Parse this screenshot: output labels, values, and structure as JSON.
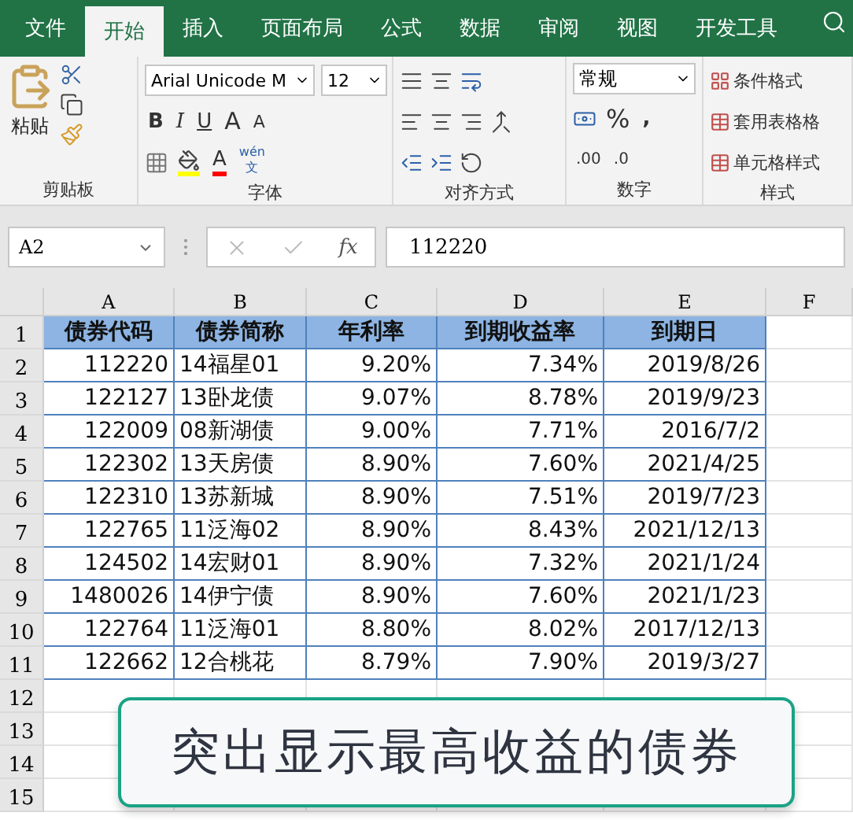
{
  "tabs": [
    {
      "label": "文件",
      "selected": false
    },
    {
      "label": "开始",
      "selected": true
    },
    {
      "label": "插入",
      "selected": false
    },
    {
      "label": "页面布局",
      "selected": false
    },
    {
      "label": "公式",
      "selected": false
    },
    {
      "label": "数据",
      "selected": false
    },
    {
      "label": "审阅",
      "selected": false
    },
    {
      "label": "视图",
      "selected": false
    },
    {
      "label": "开发工具",
      "selected": false
    }
  ],
  "ribbon": {
    "clipboard": {
      "paste": "粘贴",
      "label": "剪贴板"
    },
    "font": {
      "name": "Arial Unicode M",
      "size": "12",
      "bold": "B",
      "italic": "I",
      "underline": "U",
      "grow": "A",
      "shrink": "A",
      "font_color": "A",
      "phonetic": "wén",
      "phonetic_char": "文",
      "label": "字体"
    },
    "alignment": {
      "label": "对齐方式"
    },
    "number": {
      "format": "常规",
      "percent": "%",
      "comma": ",",
      "add_decimal": ".00",
      "remove_decimal": ".0",
      "label": "数字"
    },
    "styles": {
      "items": [
        "条件格式",
        "套用表格格",
        "单元格样式"
      ],
      "label": "样式"
    }
  },
  "formula_bar": {
    "name_box": "A2",
    "fx": "fx",
    "value": "112220"
  },
  "columns": [
    "A",
    "B",
    "C",
    "D",
    "E",
    "F"
  ],
  "header_row": {
    "number": "1",
    "cells": [
      "债券代码",
      "债券简称",
      "年利率",
      "到期收益率",
      "到期日"
    ]
  },
  "rows": [
    {
      "number": "2",
      "cells": [
        "112220",
        "14福星01",
        "9.20%",
        "7.34%",
        "2019/8/26"
      ]
    },
    {
      "number": "3",
      "cells": [
        "122127",
        "13卧龙债",
        "9.07%",
        "8.78%",
        "2019/9/23"
      ]
    },
    {
      "number": "4",
      "cells": [
        "122009",
        "08新湖债",
        "9.00%",
        "7.71%",
        "2016/7/2"
      ]
    },
    {
      "number": "5",
      "cells": [
        "122302",
        "13天房债",
        "8.90%",
        "7.60%",
        "2021/4/25"
      ]
    },
    {
      "number": "6",
      "cells": [
        "122310",
        "13苏新城",
        "8.90%",
        "7.51%",
        "2019/7/23"
      ]
    },
    {
      "number": "7",
      "cells": [
        "122765",
        "11泛海02",
        "8.90%",
        "8.43%",
        "2021/12/13"
      ]
    },
    {
      "number": "8",
      "cells": [
        "124502",
        "14宏财01",
        "8.90%",
        "7.32%",
        "2021/1/24"
      ]
    },
    {
      "number": "9",
      "cells": [
        "1480026",
        "14伊宁债",
        "8.90%",
        "7.60%",
        "2021/1/23"
      ]
    },
    {
      "number": "10",
      "cells": [
        "122764",
        "11泛海01",
        "8.80%",
        "8.02%",
        "2017/12/13"
      ]
    },
    {
      "number": "11",
      "cells": [
        "122662",
        "12合桃花",
        "8.79%",
        "7.90%",
        "2019/3/27"
      ]
    }
  ],
  "empty_rows": [
    "12",
    "13",
    "14",
    "15"
  ],
  "caption": "突出显示最高收益的债券"
}
